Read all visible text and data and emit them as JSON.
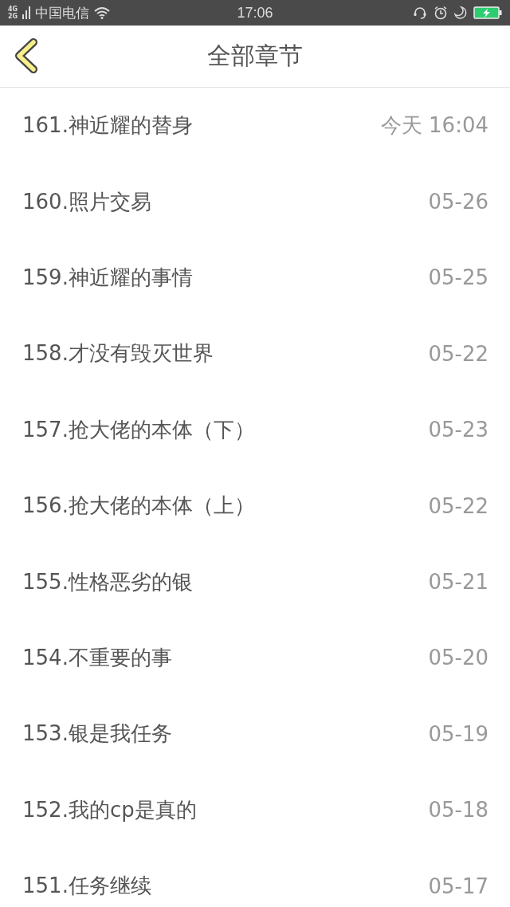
{
  "status_bar": {
    "network_top": "4G",
    "network_bottom": "2G",
    "carrier": "中国电信",
    "time": "17:06"
  },
  "header": {
    "title": "全部章节"
  },
  "chapters": [
    {
      "title": "161.神近耀的替身",
      "date": "今天 16:04"
    },
    {
      "title": "160.照片交易",
      "date": "05-26"
    },
    {
      "title": "159.神近耀的事情",
      "date": "05-25"
    },
    {
      "title": "158.才没有毁灭世界",
      "date": "05-22"
    },
    {
      "title": "157.抢大佬的本体（下）",
      "date": "05-23"
    },
    {
      "title": "156.抢大佬的本体（上）",
      "date": "05-22"
    },
    {
      "title": "155.性格恶劣的银",
      "date": "05-21"
    },
    {
      "title": "154.不重要的事",
      "date": "05-20"
    },
    {
      "title": "153.银是我任务",
      "date": "05-19"
    },
    {
      "title": "152.我的cp是真的",
      "date": "05-18"
    },
    {
      "title": "151.任务继续",
      "date": "05-17"
    }
  ]
}
